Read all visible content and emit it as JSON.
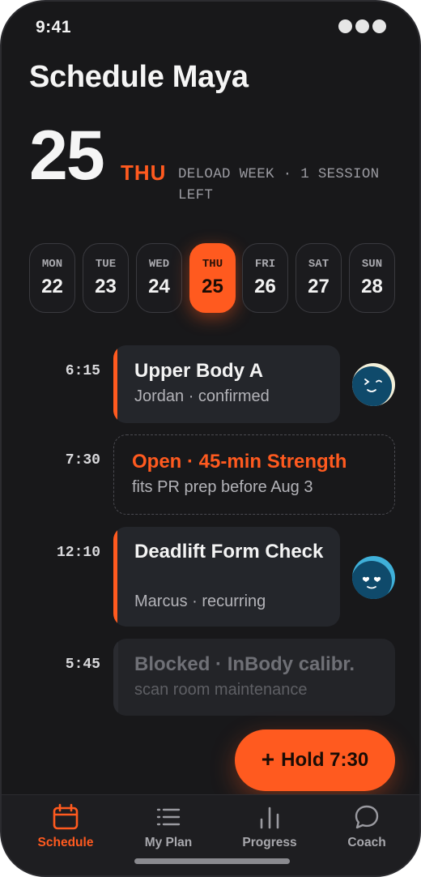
{
  "status": {
    "time": "9:41"
  },
  "header": {
    "title": "Schedule Maya",
    "date_number": "25",
    "date_dow": "THU",
    "week_note": "DELOAD WEEK · 1 SESSION LEFT"
  },
  "days": [
    {
      "dow": "MON",
      "num": "22"
    },
    {
      "dow": "TUE",
      "num": "23"
    },
    {
      "dow": "WED",
      "num": "24"
    },
    {
      "dow": "THU",
      "num": "25",
      "selected": true
    },
    {
      "dow": "FRI",
      "num": "26"
    },
    {
      "dow": "SAT",
      "num": "27"
    },
    {
      "dow": "SUN",
      "num": "28"
    }
  ],
  "sessions": [
    {
      "time": "6:15",
      "title": "Upper Body A",
      "subtitle": "Jordan · confirmed",
      "kind": "booked",
      "avatar": "winking-face-avatar"
    },
    {
      "time": "7:30",
      "title": "Open · 45-min Strength",
      "subtitle": "fits PR prep before Aug 3",
      "kind": "open"
    },
    {
      "time": "12:10",
      "title": "Deadlift Form Check",
      "subtitle": "Marcus · recurring",
      "kind": "booked",
      "avatar": "heart-eyes-face-avatar"
    },
    {
      "time": "5:45",
      "title": "Blocked · InBody calibr.",
      "subtitle": "scan room maintenance",
      "kind": "blocked"
    }
  ],
  "hold_button": {
    "label": "Hold 7:30",
    "icon": "plus-icon"
  },
  "tabbar": [
    {
      "label": "Schedule",
      "icon": "calendar-icon",
      "active": true
    },
    {
      "label": "My Plan",
      "icon": "list-icon"
    },
    {
      "label": "Progress",
      "icon": "bar-chart-icon"
    },
    {
      "label": "Coach",
      "icon": "chat-bubble-icon"
    }
  ],
  "colors": {
    "accent": "#ff5a1f",
    "background": "#18181a",
    "card": "#24262b",
    "avatar_blue": "#0f4a6b",
    "avatar_cyan": "#3fb0d9"
  }
}
